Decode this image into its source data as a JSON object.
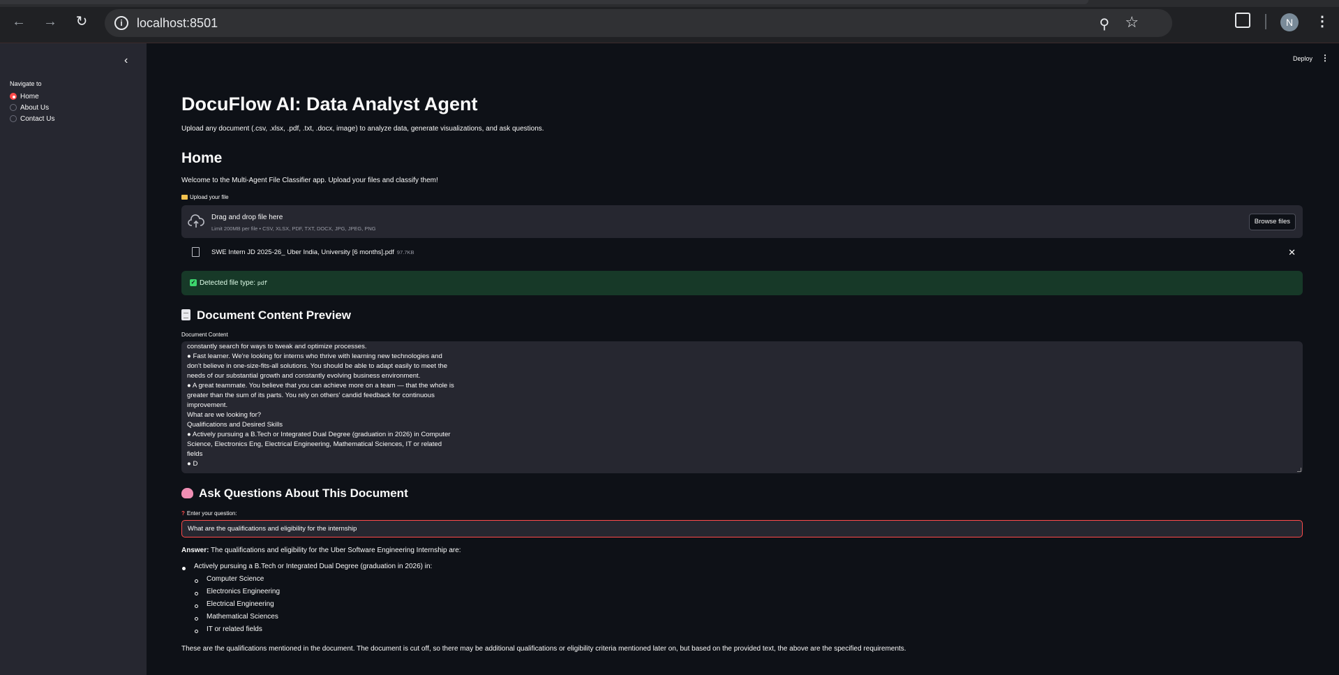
{
  "browser": {
    "url": "localhost:8501",
    "profile_initial": "N"
  },
  "sidebar": {
    "nav_label": "Navigate to",
    "options": [
      {
        "label": "Home",
        "selected": true
      },
      {
        "label": "About Us",
        "selected": false
      },
      {
        "label": "Contact Us",
        "selected": false
      }
    ]
  },
  "header": {
    "deploy_label": "Deploy"
  },
  "main": {
    "title": "DocuFlow AI: Data Analyst Agent",
    "subtitle": "Upload any document (.csv, .xlsx, .pdf, .txt, .docx, image) to analyze data, generate visualizations, and ask questions.",
    "section_title": "Home",
    "welcome": "Welcome to the Multi-Agent File Classifier app. Upload your files and classify them!",
    "uploader": {
      "label": "Upload your file",
      "drag_text": "Drag and drop file here",
      "limit_text": "Limit 200MB per file • CSV, XLSX, PDF, TXT, DOCX, JPG, JPEG, PNG",
      "browse_label": "Browse files",
      "file_name": "SWE Intern JD 2025-26_ Uber India, University [6 months].pdf",
      "file_size": "97.7KB"
    },
    "detected": {
      "text": "Detected file type: ",
      "type": "pdf"
    },
    "preview": {
      "heading": "Document Content Preview",
      "label": "Document Content",
      "lines": [
        "constantly search for ways to tweak and optimize processes.",
        "● Fast learner. We're looking for interns who thrive with learning new technologies and",
        "don't believe in one-size-fits-all solutions. You should be able to adapt easily to meet the",
        "needs of our substantial growth and constantly evolving business environment.",
        "● A great teammate. You believe that you can achieve more on a team — that the whole is",
        "greater than the sum of its parts. You rely on others' candid feedback for continuous",
        "improvement.",
        "What are we looking for?",
        "Qualifications and Desired Skills",
        "● Actively pursuing a B.Tech or Integrated Dual Degree (graduation in 2026) in Computer",
        "Science, Electronics Eng, Electrical Engineering, Mathematical Sciences, IT or related",
        "fields",
        "● D"
      ]
    },
    "ask": {
      "heading": "Ask Questions About This Document",
      "label": "Enter your question:",
      "question_value": "What are the qualifications and eligibility for the internship"
    },
    "answer": {
      "prefix": "Answer:",
      "intro": " The qualifications and eligibility for the Uber Software Engineering Internship are:",
      "bullet": "Actively pursuing a B.Tech or Integrated Dual Degree (graduation in 2026) in:",
      "sub_items": [
        "Computer Science",
        "Electronics Engineering",
        "Electrical Engineering",
        "Mathematical Sciences",
        "IT or related fields"
      ],
      "conclusion": "These are the qualifications mentioned in the document. The document is cut off, so there may be additional qualifications or eligibility criteria mentioned later on, but based on the provided text, the above are the specified requirements."
    }
  }
}
